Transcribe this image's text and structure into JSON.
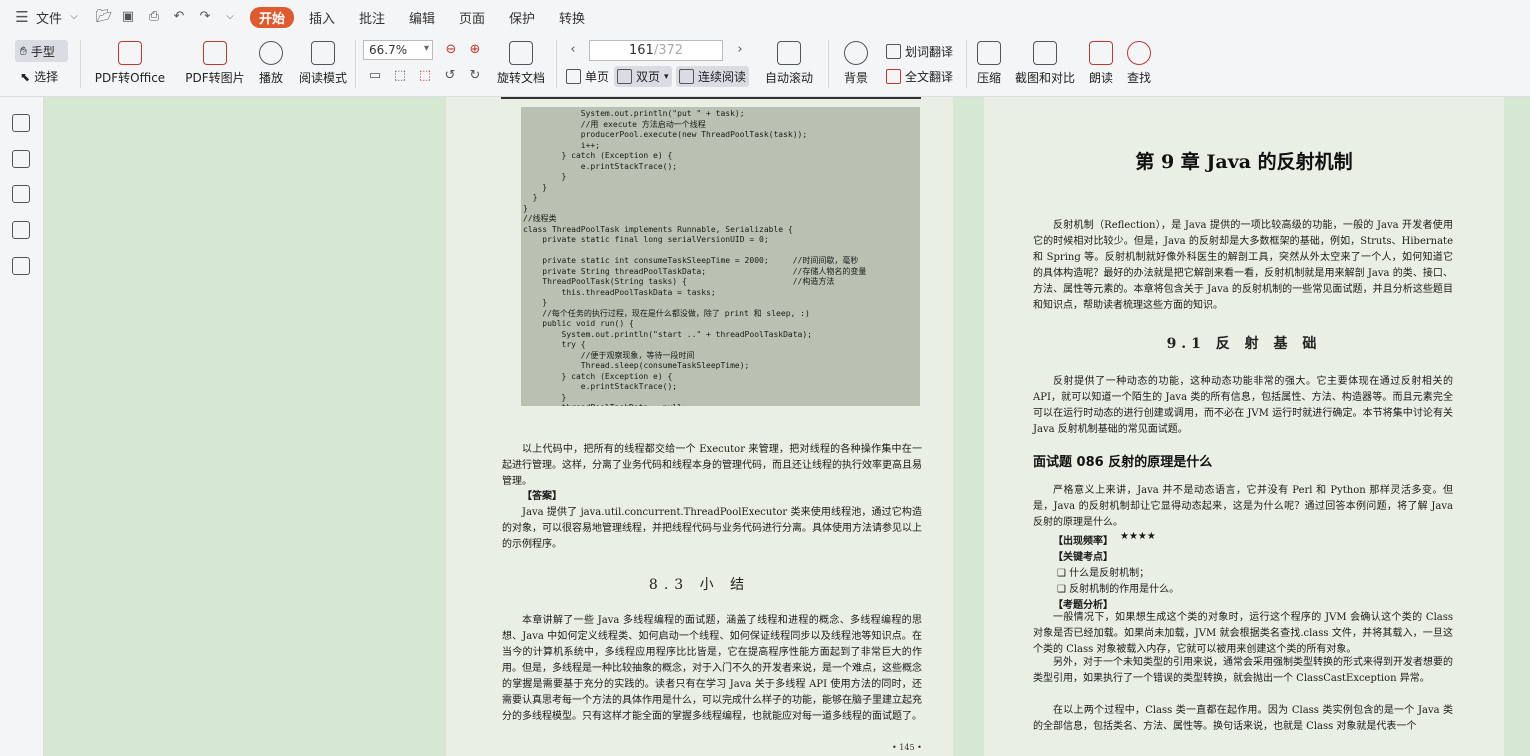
{
  "menu": {
    "file_label": "文件",
    "tabs": [
      "开始",
      "插入",
      "批注",
      "编辑",
      "页面",
      "保护",
      "转换"
    ]
  },
  "toolbar": {
    "hand": "手型",
    "select": "选择",
    "pdf_to_office": "PDF转Office",
    "pdf_to_image": "PDF转图片",
    "play": "播放",
    "read_mode": "阅读模式",
    "zoom_value": "66.7%",
    "rotate_doc": "旋转文档",
    "page_current": "161",
    "page_total": "/372",
    "single_page": "单页",
    "double_page": "双页",
    "continuous": "连续阅读",
    "auto_scroll": "自动滚动",
    "background": "背景",
    "word_translate": "划词翻译",
    "full_translate": "全文翻译",
    "compress": "压缩",
    "screenshot_compare": "截图和对比",
    "read_aloud": "朗读",
    "find": "查找"
  },
  "left_page": {
    "code": "            System.out.println(\"put \" + task);\n            //用 execute 方法启动一个线程\n            producerPool.execute(new ThreadPoolTask(task));\n            i++;\n        } catch (Exception e) {\n            e.printStackTrace();\n        }\n    }\n  }\n}\n//线程类\nclass ThreadPoolTask implements Runnable, Serializable {\n    private static final long serialVersionUID = 0;\n\n    private static int consumeTaskSleepTime = 2000;     //时间间歇，毫秒\n    private String threadPoolTaskData;                  //存储人物名的变量\n    ThreadPoolTask(String tasks) {                      //构造方法\n        this.threadPoolTaskData = tasks;\n    }\n    //每个任务的执行过程，现在是什么都没做，除了 print 和 sleep, :)\n    public void run() {\n        System.out.println(\"start ..\" + threadPoolTaskData);\n        try {\n            //便于观察现象，等待一段时间\n            Thread.sleep(consumeTaskSleepTime);\n        } catch (Exception e) {\n            e.printStackTrace();\n        }\n        threadPoolTaskData = null;\n    }\n}",
    "para1": "以上代码中，把所有的线程都交给一个 Executor 来管理，把对线程的各种操作集中在一起进行管理。这样，分离了业务代码和线程本身的管理代码，而且还让线程的执行效率更高且易管理。",
    "answer_label": "【答案】",
    "answer": "Java 提供了 java.util.concurrent.ThreadPoolExecutor 类来使用线程池，通过它构造的对象，可以很容易地管理线程，并把线程代码与业务代码进行分离。具体使用方法请参见以上的示例程序。",
    "section_title": "8.3  小  结",
    "summary": "本章讲解了一些 Java 多线程编程的面试题，涵盖了线程和进程的概念、多线程编程的思想、Java 中如何定义线程类、如何启动一个线程、如何保证线程同步以及线程池等知识点。在当今的计算机系统中，多线程应用程序比比皆是，它在提高程序性能方面起到了非常巨大的作用。但是，多线程是一种比较抽象的概念，对于入门不久的开发者来说，是一个难点，这些概念的掌握是需要基于充分的实践的。读者只有在学习 Java 关于多线程 API 使用方法的同时，还需要认真思考每一个方法的具体作用是什么，可以完成什么样子的功能，能够在脑子里建立起充分的多线程模型。只有这样才能全面的掌握多线程编程，也就能应对每一道多线程的面试题了。",
    "page_number": "• 145 •"
  },
  "right_page": {
    "chapter_title": "第 9 章  Java 的反射机制",
    "intro": "反射机制（Reflection），是 Java 提供的一项比较高级的功能，一般的 Java 开发者使用它的时候相对比较少。但是，Java 的反射却是大多数框架的基础，例如，Struts、Hibernate 和 Spring 等。反射机制就好像外科医生的解剖工具，突然从外太空来了一个人，如何知道它的具体构造呢？最好的办法就是把它解剖来看一看，反射机制就是用来解剖 Java 的类、接口、方法、属性等元素的。本章将包含关于 Java 的反射机制的一些常见面试题，并且分析这些题目和知识点，帮助读者梳理这些方面的知识。",
    "section_title": "9.1  反 射 基 础",
    "section_para": "反射提供了一种动态的功能，这种动态功能非常的强大。它主要体现在通过反射相关的 API，就可以知道一个陌生的 Java 类的所有信息，包括属性、方法、构造器等。而且元素完全可以在运行时动态的进行创建或调用，而不必在 JVM 运行时就进行确定。本节将集中讨论有关 Java 反射机制基础的常见面试题。",
    "question_title": "面试题 086   反射的原理是什么",
    "q_para": "严格意义上来讲，Java 并不是动态语言，它并没有 Perl 和 Python 那样灵活多变。但是，Java 的反射机制却让它显得动态起来，这是为什么呢？通过回答本例问题，将了解 Java 反射的原理是什么。",
    "freq_label": "【出现频率】",
    "freq_stars": "★★★★",
    "key_label": "【关键考点】",
    "key_points": [
      "❑  什么是反射机制；",
      "❑  反射机制的作用是什么。"
    ],
    "analysis_label": "【考题分析】",
    "analysis1": "一般情况下，如果想生成这个类的对象时，运行这个程序的 JVM 会确认这个类的 Class 对象是否已经加载。如果尚未加载，JVM 就会根据类名查找.class 文件，并将其载入，一旦这个类的 Class 对象被载入内存，它就可以被用来创建这个类的所有对象。",
    "analysis2": "另外，对于一个未知类型的引用来说，通常会采用强制类型转换的形式来得到开发者想要的类型引用，如果执行了一个错误的类型转换，就会抛出一个 ClassCastException 异常。",
    "analysis3": "在以上两个过程中，Class 类一直都在起作用。因为 Class 类实例包含的是一个 Java 类的全部信息，包括类名、方法、属性等。换句话来说，也就是 Class 对象就是代表一个"
  }
}
